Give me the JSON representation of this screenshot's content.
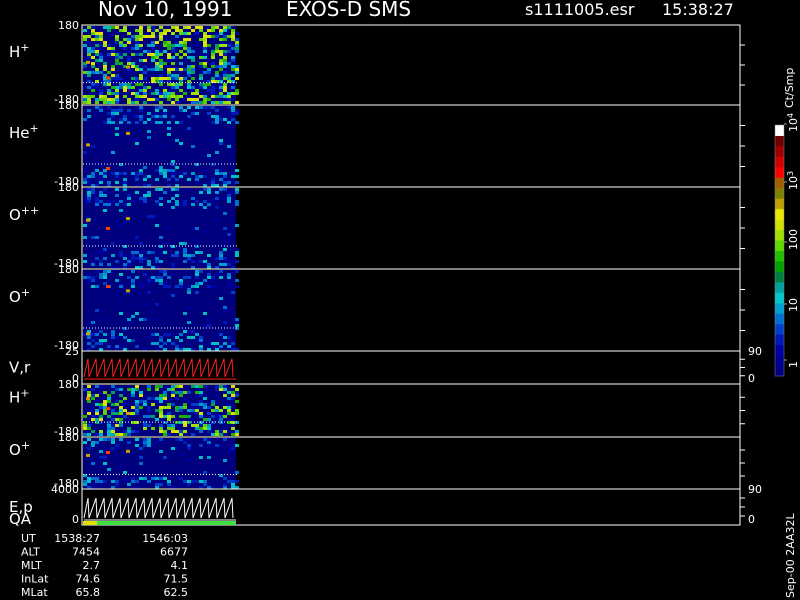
{
  "header": {
    "date": "Nov 10, 1991",
    "instrument": "EXOS-D SMS",
    "file": "s1111005.esr",
    "time": "15:38:27"
  },
  "panels": [
    {
      "id": "h-plus-1",
      "label_base": "H",
      "label_sup": "+",
      "ytop": "180",
      "ybottom": "-180",
      "chart_type": "heatmap"
    },
    {
      "id": "he-plus",
      "label_base": "He",
      "label_sup": "+",
      "ytop": "180",
      "ybottom": "-180",
      "chart_type": "heatmap"
    },
    {
      "id": "o-plus-plus",
      "label_base": "O",
      "label_sup": "++",
      "ytop": "180",
      "ybottom": "-180",
      "chart_type": "heatmap"
    },
    {
      "id": "o-plus-1",
      "label_base": "O",
      "label_sup": "+",
      "ytop": "180",
      "ybottom": "-180",
      "chart_type": "heatmap"
    },
    {
      "id": "vr",
      "label_base": "V,r",
      "label_sup": "",
      "ytop": "25",
      "ybottom": "0",
      "right_top": "90",
      "right_bottom": "0",
      "chart_type": "line"
    },
    {
      "id": "h-plus-2",
      "label_base": "H",
      "label_sup": "+",
      "ytop": "180",
      "ybottom": "-180",
      "chart_type": "heatmap"
    },
    {
      "id": "o-plus-2",
      "label_base": "O",
      "label_sup": "+",
      "ytop": "180",
      "ybottom": "-180",
      "chart_type": "heatmap"
    },
    {
      "id": "ep",
      "label_base": "E,p",
      "label_sup": "",
      "label2": "QA",
      "ytop": "4000",
      "ybottom": "0",
      "right_top": "90",
      "right_bottom": "0",
      "chart_type": "line"
    }
  ],
  "colorbar": {
    "unit": "Ct/Smp",
    "labels": [
      {
        "text": "1",
        "sup": ""
      },
      {
        "text": "10",
        "sup": ""
      },
      {
        "text": "100",
        "sup": ""
      },
      {
        "text": "10",
        "sup": "3"
      },
      {
        "text": "10",
        "sup": "4"
      }
    ],
    "colors": [
      "#000080",
      "#000090",
      "#0000a0",
      "#0018b4",
      "#0040c8",
      "#0070d0",
      "#00a0d0",
      "#00c8c8",
      "#00a0a0",
      "#008040",
      "#00a000",
      "#20c000",
      "#60d800",
      "#a0e000",
      "#d0e000",
      "#e8e800",
      "#c0a000",
      "#808000",
      "#a06000",
      "#ff0000",
      "#d00000",
      "#a00000",
      "#700000",
      "#ffffff"
    ]
  },
  "footer": {
    "rows": [
      {
        "label": "UT",
        "v1": "1538:27",
        "v2": "1546:03"
      },
      {
        "label": "ALT",
        "v1": "7454",
        "v2": "6677"
      },
      {
        "label": "MLT",
        "v1": "2.7",
        "v2": "4.1"
      },
      {
        "label": "InLat",
        "v1": "74.6",
        "v2": "71.5"
      },
      {
        "label": "MLat",
        "v1": "65.8",
        "v2": "62.5"
      }
    ],
    "version": "Sep-00 2AA32L"
  },
  "chart_data": {
    "type": "heatmap",
    "title": "Nov 10, 1991 EXOS-D SMS",
    "series": [
      {
        "name": "H+"
      },
      {
        "name": "He+"
      },
      {
        "name": "O++"
      },
      {
        "name": "O+"
      },
      {
        "name": "V,r"
      },
      {
        "name": "H+"
      },
      {
        "name": "O+"
      },
      {
        "name": "E,p"
      }
    ],
    "x": [
      "1538:27",
      "1546:03"
    ],
    "ylim": [
      -180,
      180
    ],
    "colorscale_range": [
      1,
      10000
    ],
    "log_color_scale": true
  }
}
